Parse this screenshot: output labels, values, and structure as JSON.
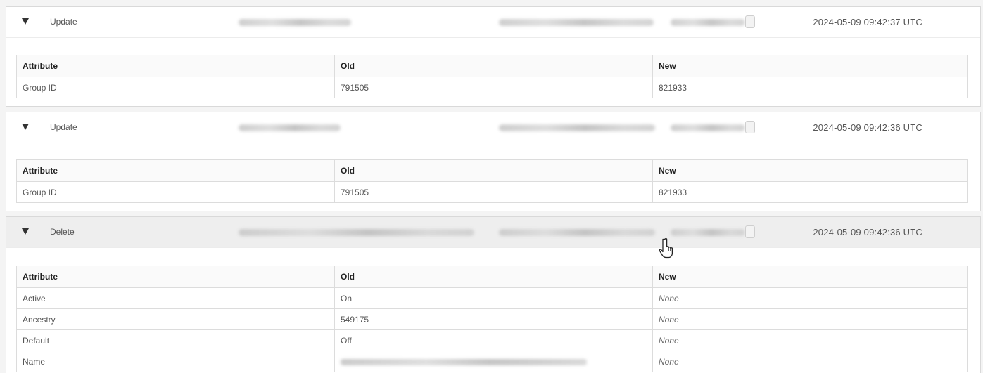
{
  "entries": [
    {
      "action": "Update",
      "timestamp": "2024-05-09 09:42:37 UTC",
      "headers": {
        "attribute": "Attribute",
        "old": "Old",
        "new": "New"
      },
      "rows": [
        {
          "attribute": "Group ID",
          "old": "791505",
          "new": "821933"
        }
      ]
    },
    {
      "action": "Update",
      "timestamp": "2024-05-09 09:42:36 UTC",
      "headers": {
        "attribute": "Attribute",
        "old": "Old",
        "new": "New"
      },
      "rows": [
        {
          "attribute": "Group ID",
          "old": "791505",
          "new": "821933"
        }
      ]
    },
    {
      "action": "Delete",
      "timestamp": "2024-05-09 09:42:36 UTC",
      "headers": {
        "attribute": "Attribute",
        "old": "Old",
        "new": "New"
      },
      "rows": [
        {
          "attribute": "Active",
          "old": "On",
          "new": "None"
        },
        {
          "attribute": "Ancestry",
          "old": "549175",
          "new": "None"
        },
        {
          "attribute": "Default",
          "old": "Off",
          "new": "None"
        },
        {
          "attribute": "Name",
          "old": "",
          "new": "None"
        }
      ]
    }
  ],
  "icons": {
    "toggle": "triangle-down-icon",
    "cursor": "hand-pointer-icon"
  },
  "colors": {
    "active_header": "#eeeeee",
    "border": "#d9d9d9"
  }
}
